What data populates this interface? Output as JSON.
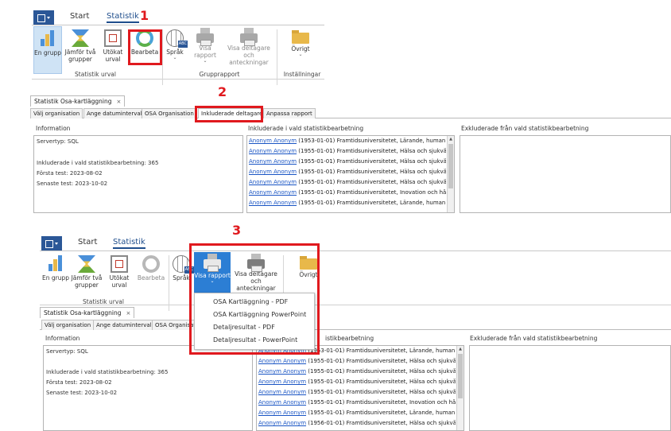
{
  "ribbon": {
    "tabs": [
      "Start",
      "Statistik"
    ],
    "buttons": {
      "en_grupp": "En grupp",
      "jamfor_1": "Jämför två",
      "jamfor_2": "grupper",
      "utokat_1": "Utökat",
      "utokat_2": "urval",
      "bearbeta": "Bearbeta",
      "sprak": "Språk",
      "visa_rapport": "Visa rapport",
      "visa_delt_1": "Visa deltagare",
      "visa_delt_2": "och anteckningar",
      "ovrigt": "Övrigt"
    },
    "groups": {
      "statistik_urval": "Statistik urval",
      "grupprapport": "Grupprapport",
      "installningar": "Inställningar"
    }
  },
  "document": {
    "tab_title": "Statistik Osa-kartläggning",
    "close_glyph": "×",
    "subtabs": [
      "Välj organisation",
      "Ange datumintervall",
      "OSA Organisation",
      "Inkluderade deltagare",
      "Anpassa rapport"
    ],
    "subtabs_truncated": [
      "Välj organisation",
      "Ange datumintervall",
      "OSA Organisat"
    ],
    "panels": {
      "information": "Information",
      "included": "Inkluderade i vald statistikbearbetning",
      "included_cut": "istikbearbetning",
      "excluded": "Exkluderade från vald statistikbearbetning"
    },
    "info": {
      "server": "Servertyp: SQL",
      "count": "Inkluderade i vald statistikbearbetning: 365",
      "first": "Första test: 2023-08-02",
      "last": "Senaste test: 2023-10-02"
    }
  },
  "participants_top": [
    {
      "name": "Anonym Anonym",
      "rest": " (1953-01-01) Framtidsuniversitetet, Lärande, humaniora"
    },
    {
      "name": "Anonym Anonym",
      "rest": " (1955-01-01) Framtidsuniversitetet, Hälsa och sjukvård"
    },
    {
      "name": "Anonym Anonym",
      "rest": " (1955-01-01) Framtidsuniversitetet, Hälsa och sjukvård,"
    },
    {
      "name": "Anonym Anonym",
      "rest": " (1955-01-01) Framtidsuniversitetet, Hälsa och sjukvård,"
    },
    {
      "name": "Anonym Anonym",
      "rest": " (1955-01-01) Framtidsuniversitetet, Hälsa och sjukvård,"
    },
    {
      "name": "Anonym Anonym",
      "rest": " (1955-01-01) Framtidsuniversitetet, Inovation och hållba"
    },
    {
      "name": "Anonym Anonym",
      "rest": " (1955-01-01) Framtidsuniversitetet, Lärande, humaniora"
    }
  ],
  "participants_bottom": [
    {
      "name": "Anonym Anonym",
      "rest": " (1953-01-01) Framtidsuniversitetet, Lärande, humaniora"
    },
    {
      "name": "Anonym Anonym",
      "rest": " (1955-01-01) Framtidsuniversitetet, Hälsa och sjukvård"
    },
    {
      "name": "Anonym Anonym",
      "rest": " (1955-01-01) Framtidsuniversitetet, Hälsa och sjukvård,"
    },
    {
      "name": "Anonym Anonym",
      "rest": " (1955-01-01) Framtidsuniversitetet, Hälsa och sjukvård,"
    },
    {
      "name": "Anonym Anonym",
      "rest": " (1955-01-01) Framtidsuniversitetet, Hälsa och sjukvård,"
    },
    {
      "name": "Anonym Anonym",
      "rest": " (1955-01-01) Framtidsuniversitetet, Inovation och hållba"
    },
    {
      "name": "Anonym Anonym",
      "rest": " (1955-01-01) Framtidsuniversitetet, Lärande, humaniora"
    },
    {
      "name": "Anonym Anonym",
      "rest": " (1956-01-01) Framtidsuniversitetet, Hälsa och sjukvård"
    }
  ],
  "dropdown": {
    "items": [
      "OSA Kartläggning - PDF",
      "OSA Kartläggning PowerPoint",
      "Detaljresultat - PDF",
      "Detaljresultat - PowerPoint"
    ]
  },
  "callouts": [
    "1",
    "2",
    "3"
  ],
  "icons": {
    "app_menu": "app-menu-icon",
    "en_grupp": "bar-chart-icon",
    "jamfor": "compare-icon",
    "utokat": "frame-icon",
    "bearbeta": "refresh-icon",
    "sprak": "language-globe-icon",
    "visa_rapport": "printer-icon",
    "visa_deltagare": "printer-icon",
    "ovrigt": "folder-icon"
  },
  "colors": {
    "accent": "#2b5797",
    "selected_button": "#2c7ed4",
    "link": "#1a55c4",
    "callout": "#e0191e"
  }
}
